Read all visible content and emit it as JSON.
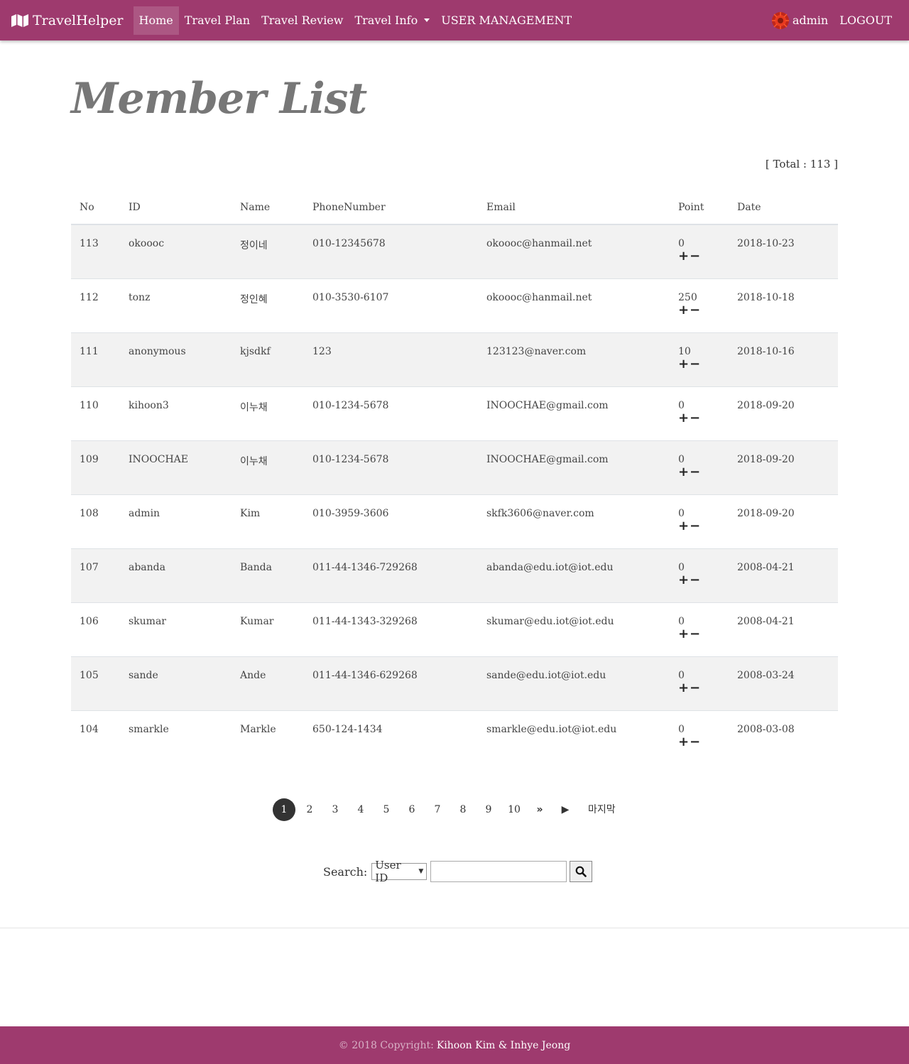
{
  "nav": {
    "brand": "TravelHelper",
    "links": [
      "Home",
      "Travel Plan",
      "Travel Review",
      "Travel Info",
      "USER MANAGEMENT"
    ],
    "user": "admin",
    "logout": "LOGOUT",
    "color": "#9e3a6e"
  },
  "page": {
    "title": "Member List",
    "total": "[ Total : 113 ]"
  },
  "table": {
    "headers": [
      "No",
      "ID",
      "Name",
      "PhoneNumber",
      "Email",
      "Point",
      "Date"
    ],
    "point_controls": [
      "+",
      "−"
    ],
    "rows": [
      [
        "113",
        "okoooc",
        "정이네",
        "010-12345678",
        "okoooc@hanmail.net",
        "0",
        "2018-10-23"
      ],
      [
        "112",
        "tonz",
        "정인혜",
        "010-3530-6107",
        "okoooc@hanmail.net",
        "250",
        "2018-10-18"
      ],
      [
        "111",
        "anonymous",
        "kjsdkf",
        "123",
        "123123@naver.com",
        "10",
        "2018-10-16"
      ],
      [
        "110",
        "kihoon3",
        "이누채",
        "010-1234-5678",
        "INOOCHAE@gmail.com",
        "0",
        "2018-09-20"
      ],
      [
        "109",
        "INOOCHAE",
        "이누채",
        "010-1234-5678",
        "INOOCHAE@gmail.com",
        "0",
        "2018-09-20"
      ],
      [
        "108",
        "admin",
        "Kim",
        "010-3959-3606",
        "skfk3606@naver.com",
        "0",
        "2018-09-20"
      ],
      [
        "107",
        "abanda",
        "Banda",
        "011-44-1346-729268",
        "abanda@edu.iot@iot.edu",
        "0",
        "2008-04-21"
      ],
      [
        "106",
        "skumar",
        "Kumar",
        "011-44-1343-329268",
        "skumar@edu.iot@iot.edu",
        "0",
        "2008-04-21"
      ],
      [
        "105",
        "sande",
        "Ande",
        "011-44-1346-629268",
        "sande@edu.iot@iot.edu",
        "0",
        "2008-03-24"
      ],
      [
        "104",
        "smarkle",
        "Markle",
        "650-124-1434",
        "smarkle@edu.iot@iot.edu",
        "0",
        "2008-03-08"
      ]
    ]
  },
  "pagination": {
    "pages": [
      "1",
      "2",
      "3",
      "4",
      "5",
      "6",
      "7",
      "8",
      "9",
      "10"
    ],
    "current": "1",
    "next_group": "»",
    "next": "▶",
    "last": "마지막"
  },
  "search": {
    "label": "Search:",
    "selected": "User ID",
    "value": ""
  },
  "footer": {
    "copyright": "© 2018 Copyright:",
    "authors": "Kihoon Kim & Inhye Jeong"
  }
}
